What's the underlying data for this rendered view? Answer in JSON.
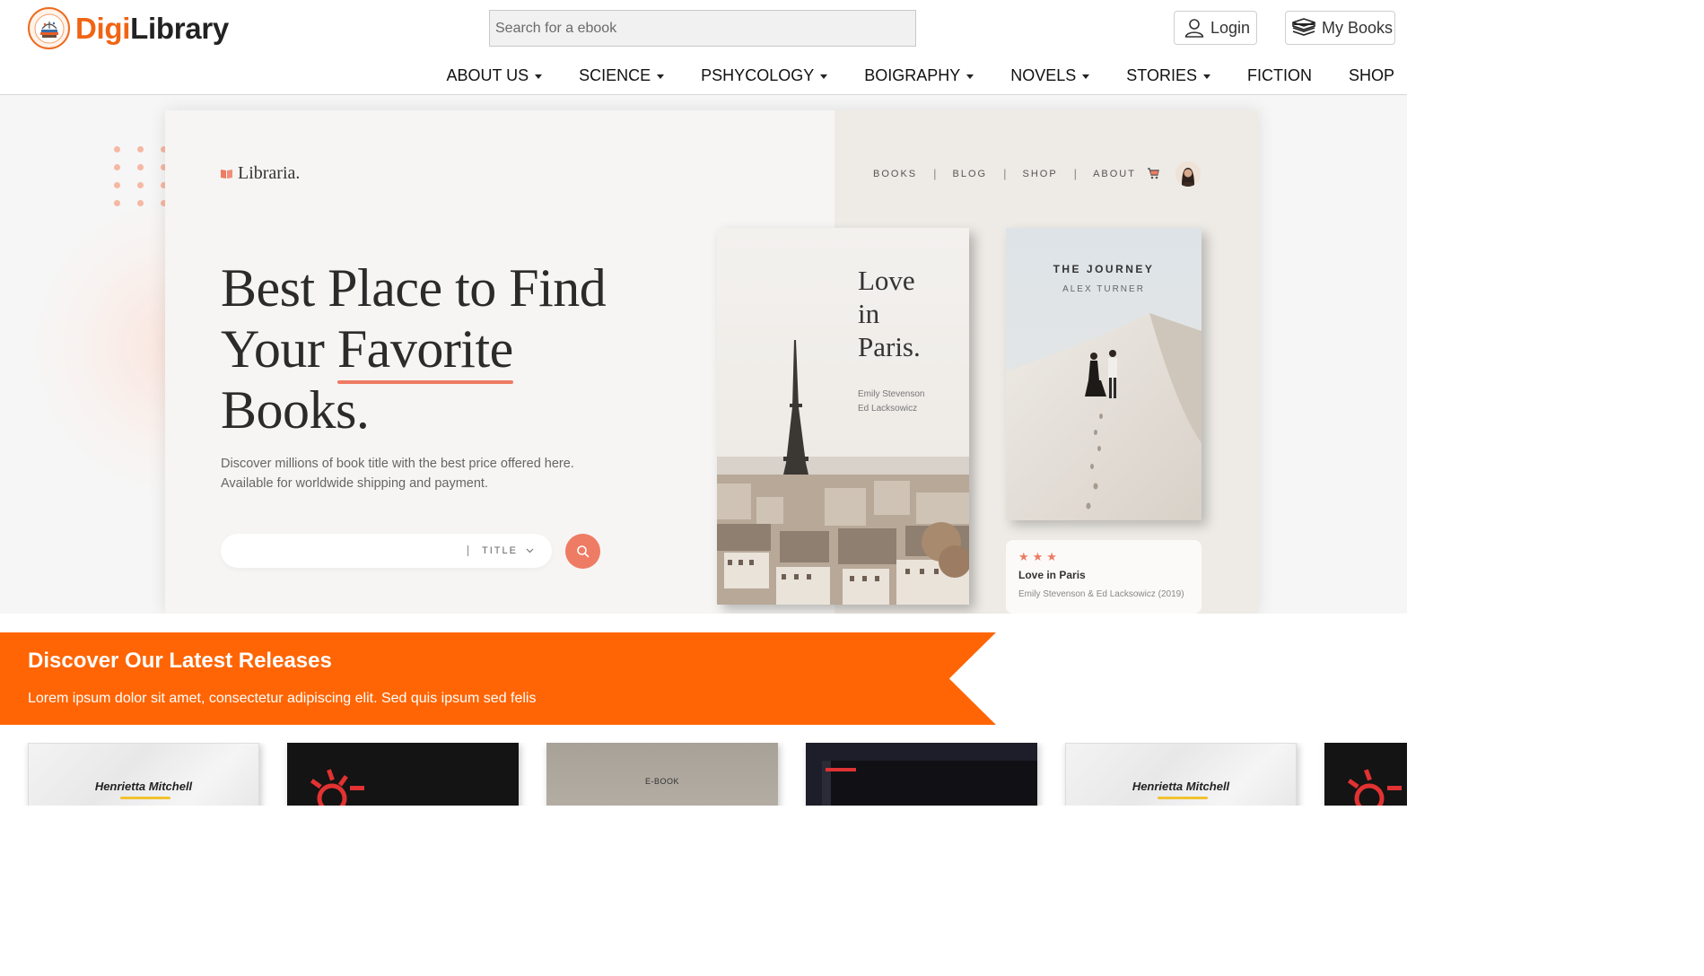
{
  "brand": {
    "part1": "Digi",
    "part2": "Library"
  },
  "search": {
    "placeholder": "Search for a ebook",
    "value": ""
  },
  "header_buttons": {
    "login": "Login",
    "my_books": "My Books"
  },
  "nav": {
    "items": [
      {
        "label": "ABOUT US",
        "dropdown": true
      },
      {
        "label": "SCIENCE",
        "dropdown": true
      },
      {
        "label": "PSHYCOLOGY",
        "dropdown": true
      },
      {
        "label": "BOIGRAPHY",
        "dropdown": true
      },
      {
        "label": "NOVELS",
        "dropdown": true
      },
      {
        "label": "STORIES",
        "dropdown": true
      },
      {
        "label": "FICTION",
        "dropdown": false
      },
      {
        "label": "SHOP",
        "dropdown": false
      }
    ]
  },
  "hero": {
    "logo": "Libraria.",
    "nav": [
      "BOOKS",
      "BLOG",
      "SHOP",
      "ABOUT"
    ],
    "separator": "|",
    "heading": {
      "line1": "Best Place to Find",
      "line2_prefix": "Your ",
      "line2_highlight": "Favorite",
      "line3": "Books."
    },
    "subtext": {
      "line1": "Discover millions of book title with the best price offered here.",
      "line2": "Available for worldwide shipping and payment."
    },
    "search_filter": "TITLE",
    "book1": {
      "title_lines": [
        "Love",
        "in",
        "Paris."
      ],
      "authors": [
        "Emily Stevenson",
        "Ed Lacksowicz"
      ]
    },
    "book2": {
      "title": "THE JOURNEY",
      "author": "ALEX TURNER"
    },
    "card": {
      "stars": "★★★",
      "rating": 3,
      "title": "Love in Paris",
      "subtitle": "Emily Stevenson & Ed Lacksowicz (2019)"
    }
  },
  "banner": {
    "title": "Discover Our Latest Releases",
    "subtitle": "Lorem ipsum dolor sit amet, consectetur adipiscing elit. Sed quis ipsum sed felis"
  },
  "releases": [
    {
      "style": "paper",
      "author": "Henrietta Mitchell"
    },
    {
      "style": "dark"
    },
    {
      "style": "beige",
      "label": "E-BOOK"
    },
    {
      "style": "navy"
    },
    {
      "style": "paper",
      "author": "Henrietta Mitchell"
    },
    {
      "style": "dark"
    }
  ],
  "colors": {
    "brand_orange": "#f06414",
    "banner_orange": "#ff6504",
    "accent_coral": "#ee7b63"
  }
}
